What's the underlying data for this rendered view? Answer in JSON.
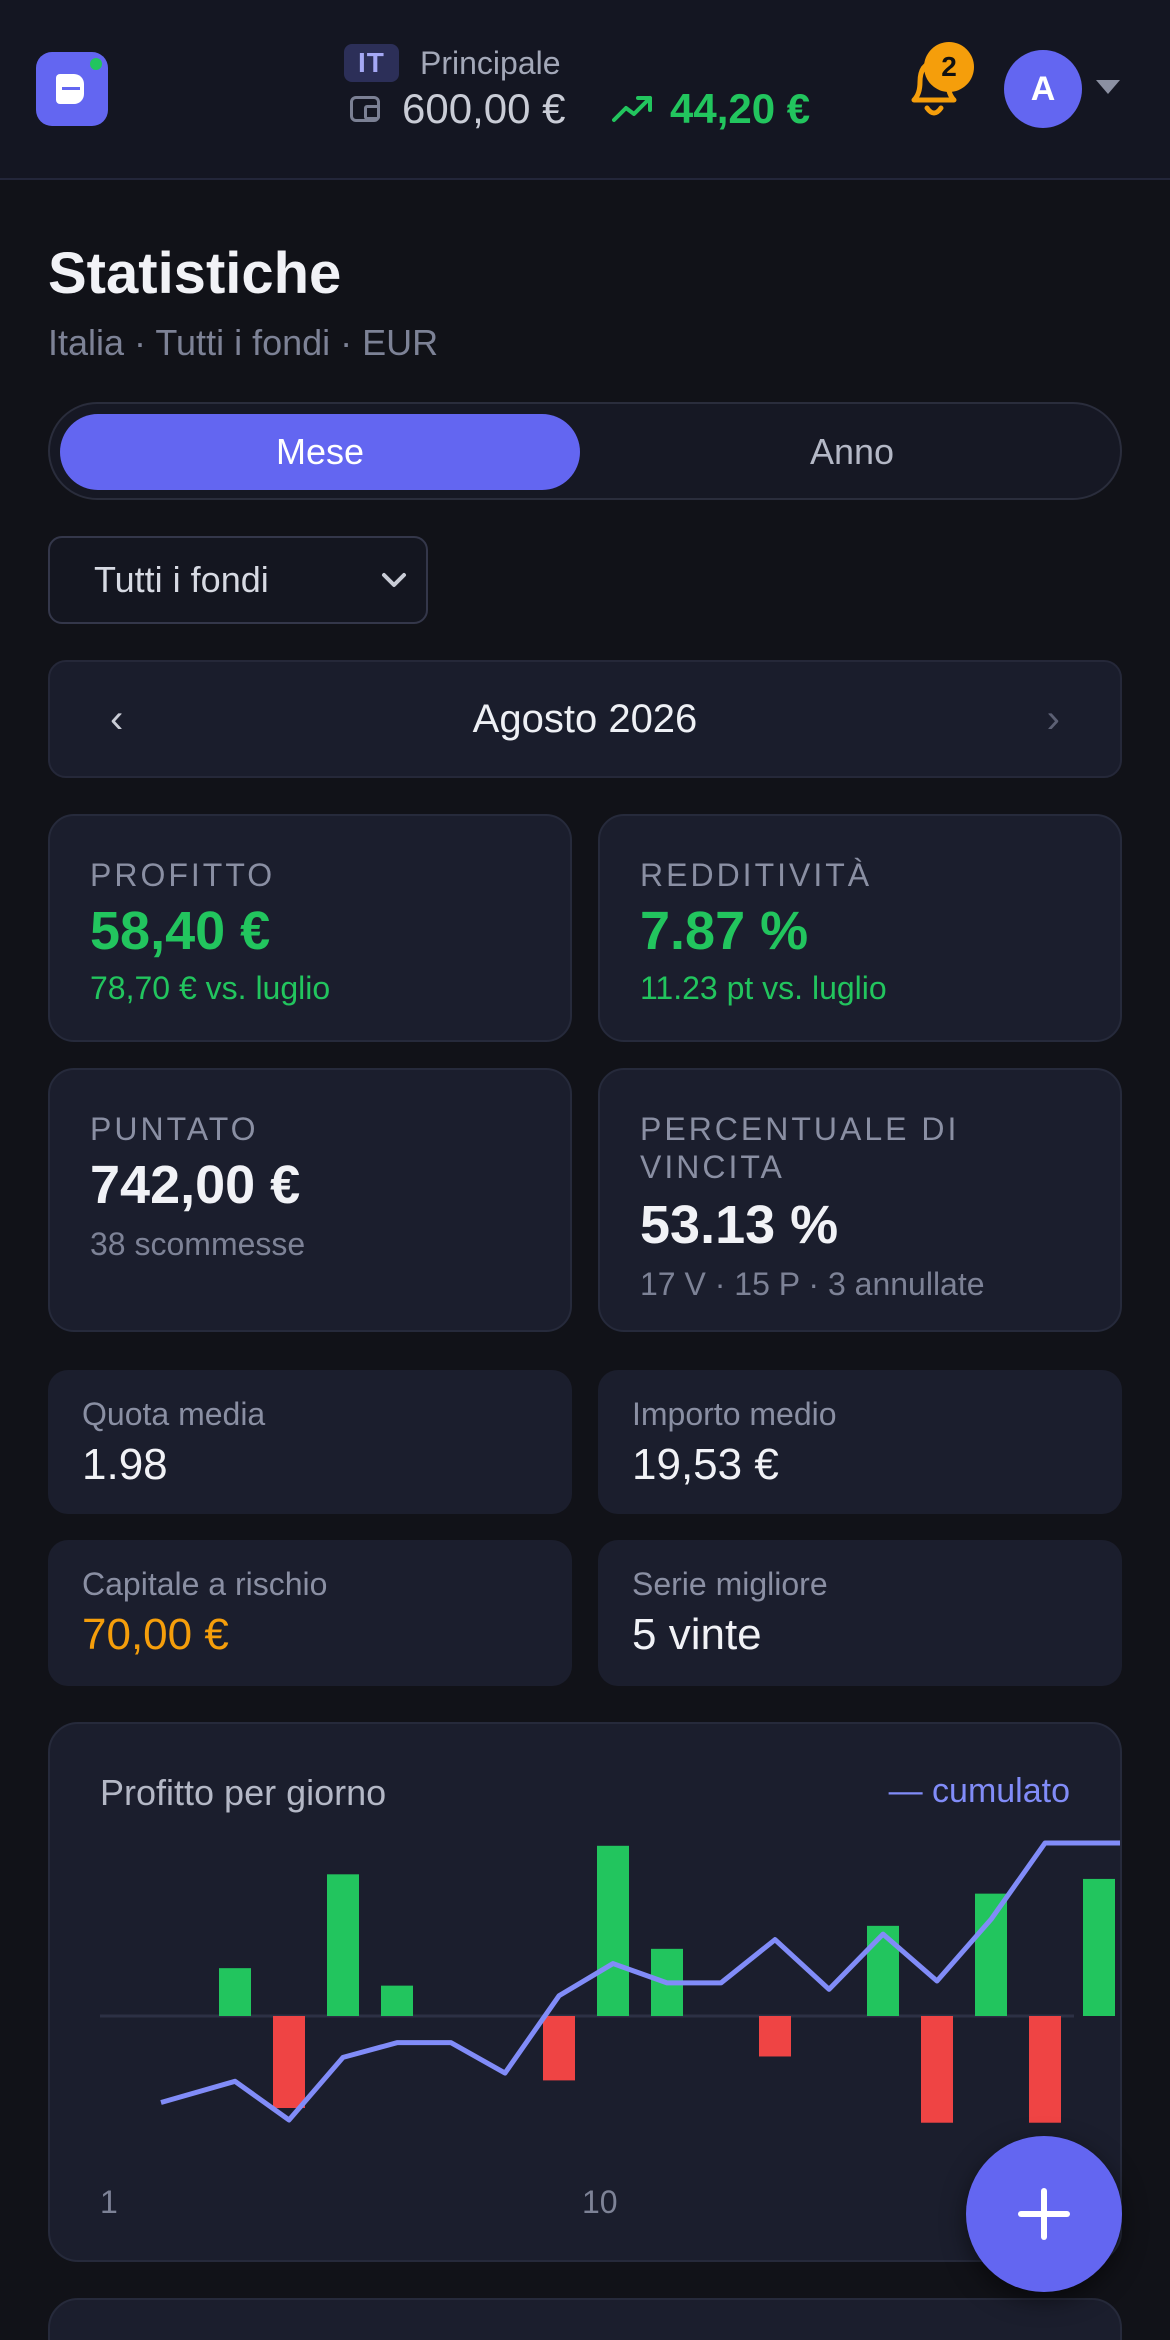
{
  "header": {
    "country_code": "IT",
    "account_name": "Principale",
    "balance": "600,00 €",
    "gain": "44,20 €",
    "notifications_count": "2",
    "avatar_initial": "A",
    "icons": [
      "logo-icon",
      "wallet-icon",
      "trend-up-icon",
      "bell-icon",
      "chevron-down-icon"
    ]
  },
  "page": {
    "title": "Statistiche",
    "subtitle": "Italia · Tutti i fondi · EUR"
  },
  "period_toggle": {
    "options": [
      "Mese",
      "Anno"
    ],
    "selected": "Mese"
  },
  "fund_filter": {
    "selected": "Tutti i fondi"
  },
  "month_nav": {
    "prev": "‹",
    "label": "Agosto 2026",
    "next": "›"
  },
  "stats": {
    "profit": {
      "label": "PROFITTO",
      "value": "58,40 €",
      "sub": "78,70 € vs. luglio"
    },
    "roi": {
      "label": "REDDITIVITÀ",
      "value": "7.87 %",
      "sub": "11.23 pt vs. luglio"
    },
    "staked": {
      "label": "PUNTATO",
      "value": "742,00 €",
      "sub": "38 scommesse"
    },
    "winrate": {
      "label_line1": "PERCENTUALE DI",
      "label_line2": "VINCITA",
      "value": "53.13 %",
      "sub": "17 V · 15 P · 3 annullate"
    }
  },
  "mini_stats": {
    "avg_odds": {
      "label": "Quota media",
      "value": "1.98"
    },
    "avg_stake": {
      "label": "Importo medio",
      "value": "19,53 €"
    },
    "at_risk": {
      "label": "Capitale a rischio",
      "value": "70,00 €"
    },
    "best_streak": {
      "label": "Serie migliore",
      "value": "5 vinte"
    }
  },
  "colors": {
    "accent": "#6366f1",
    "positive": "#22c55e",
    "negative": "#ef4444",
    "warning": "#f59e0b",
    "line": "#818cf8"
  },
  "chart_data": {
    "type": "bar",
    "title": "Profitto per giorno",
    "legend": "— cumulato",
    "x_ticks": [
      "1",
      "10"
    ],
    "days": [
      1,
      2,
      3,
      4,
      5,
      6,
      7,
      8,
      9,
      10,
      11,
      12,
      13,
      14,
      15,
      16,
      17,
      18
    ],
    "series": [
      {
        "values": [
          0,
          5.2,
          -10,
          15.4,
          3.3,
          0,
          0,
          -7,
          18.5,
          7.3,
          0,
          -4.4,
          0,
          9.8,
          -11.6,
          13.3,
          -11.6,
          14.9
        ]
      },
      {
        "name": "cumulato",
        "values": [
          -9.4,
          -7.1,
          -11.3,
          -4.5,
          -2.9,
          -2.9,
          -6.2,
          2.2,
          5.7,
          3.6,
          3.6,
          8.3,
          2.9,
          8.9,
          3.8,
          10.5,
          18.8,
          18.8
        ]
      }
    ],
    "ylim": [
      -18,
      20
    ],
    "grid": "zero line only"
  }
}
